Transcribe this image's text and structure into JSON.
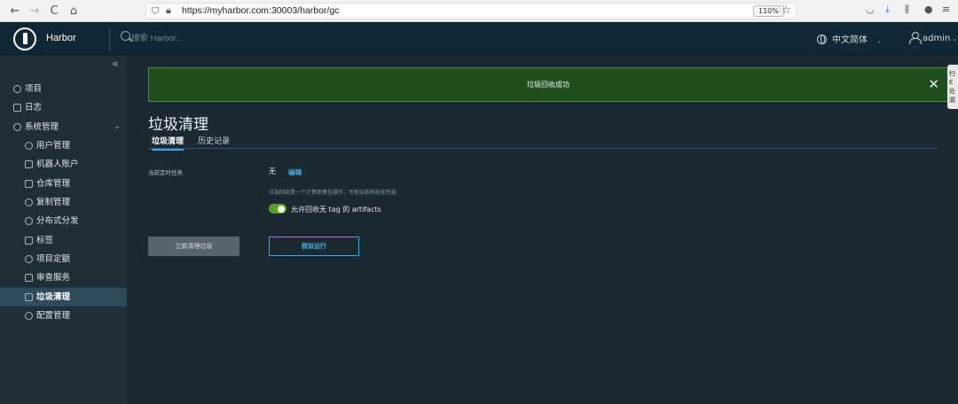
{
  "browser": {
    "url": "https://myharbor.com:30003/harbor/gc",
    "zoom": "110%",
    "back": "←",
    "forward": "→",
    "reload": "C",
    "home": "⌂",
    "star": "☆"
  },
  "header": {
    "brand": "Harbor",
    "search_placeholder": "搜索 Harbor...",
    "language": "中文简体",
    "user": "admin",
    "chevron": "⌄"
  },
  "sidebar": {
    "collapse": "«",
    "items": [
      {
        "label": "项目"
      },
      {
        "label": "日志"
      },
      {
        "label": "系统管理",
        "chevron": "⌄"
      },
      {
        "label": "用户管理"
      },
      {
        "label": "机器人账户"
      },
      {
        "label": "仓库管理"
      },
      {
        "label": "复制管理"
      },
      {
        "label": "分布式分发"
      },
      {
        "label": "标签"
      },
      {
        "label": "项目定额"
      },
      {
        "label": "审查服务"
      },
      {
        "label": "垃圾清理"
      },
      {
        "label": "配置管理"
      }
    ]
  },
  "alert": {
    "message": "垃圾回收成功",
    "close": "✕"
  },
  "side_tab": {
    "text": "扫 E 处 漏"
  },
  "page": {
    "title": "垃圾清理",
    "tabs": [
      {
        "label": "垃圾清理"
      },
      {
        "label": "历史记录"
      }
    ],
    "schedule_label": "当前定时任务",
    "schedule_value": "无",
    "edit_label": "编辑",
    "help_text": "垃圾回收是一个计算密集型操作，可能会影响仓库性能",
    "toggle_label": "允许回收无 tag 的 artifacts",
    "gc_button": "立即清理垃圾",
    "dry_run_button": "模拟运行"
  },
  "colors": {
    "header_bg": "#102833",
    "sidebar_bg": "#1f2f38",
    "alert_bg": "#1f4e1f",
    "accent": "#4aa3d8",
    "toggle_on": "#5aa220"
  }
}
